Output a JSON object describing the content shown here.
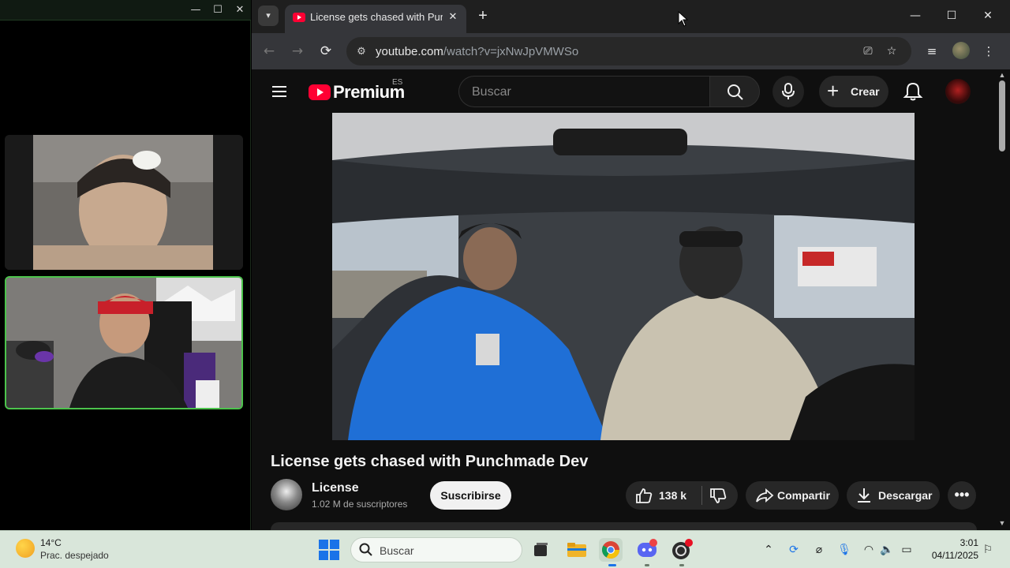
{
  "call_window": {
    "title_controls": {
      "minimize": "—",
      "maximize": "☐",
      "close": "✕"
    }
  },
  "browser": {
    "tab": {
      "title": "License gets chased with Punchmade Dev",
      "close": "✕"
    },
    "new_tab": "+",
    "window_controls": {
      "minimize": "—",
      "maximize": "☐",
      "close": "✕"
    },
    "address_bar": {
      "host": "youtube.com",
      "path": "/watch?v=jxNwJpVMWSo"
    },
    "nav": {
      "back": "←",
      "forward": "→",
      "reload": "⟳"
    },
    "menu": "⋮"
  },
  "youtube": {
    "logo_text": "Premium",
    "region": "ES",
    "search_placeholder": "Buscar",
    "create_label": "Crear",
    "create_plus": "+",
    "video": {
      "title": "License gets chased with Punchmade Dev",
      "channel": "License",
      "subscribers": "1.02 M de suscriptores",
      "subscribe_label": "Suscribirse",
      "likes": "138 k",
      "share_label": "Compartir",
      "download_label": "Descargar",
      "more": "•••"
    }
  },
  "taskbar": {
    "weather": {
      "temperature": "14°C",
      "condition": "Prac. despejado"
    },
    "search_placeholder": "Buscar",
    "clock": {
      "time": "3:01",
      "date": "04/11/2025"
    },
    "tray": {
      "chevron": "⌃"
    }
  },
  "colors": {
    "youtube_red": "#ff0033",
    "yt_background": "#0f0f0f",
    "call_active_border": "#4cc34c",
    "taskbar_bg": "#d9e6da"
  }
}
